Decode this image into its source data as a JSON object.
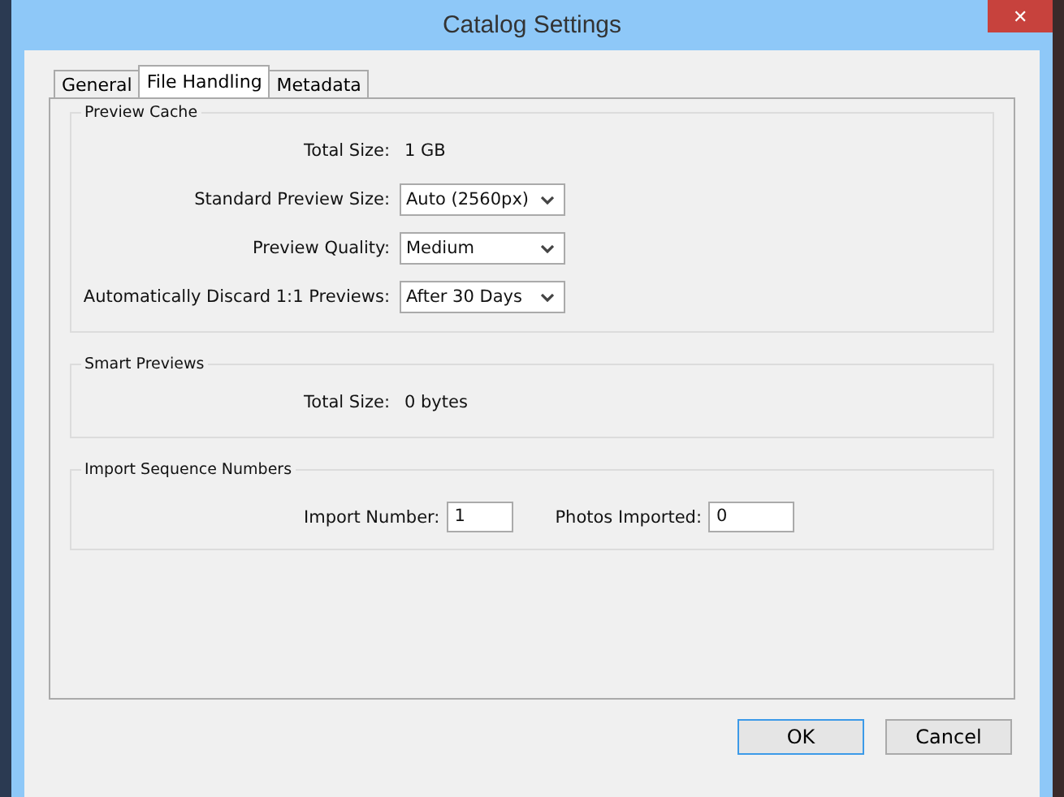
{
  "window": {
    "title": "Catalog Settings",
    "close": "✕"
  },
  "tabs": [
    {
      "label": "General",
      "selected": false
    },
    {
      "label": "File Handling",
      "selected": true
    },
    {
      "label": "Metadata",
      "selected": false
    }
  ],
  "groups": [
    {
      "title": "Preview Cache",
      "rows": [
        {
          "kind": "value",
          "label": "Total Size:",
          "value": "1 GB"
        },
        {
          "kind": "dropdown",
          "label": "Standard Preview Size:",
          "value": "Auto (2560px)"
        },
        {
          "kind": "dropdown",
          "label": "Preview Quality:",
          "value": "Medium"
        },
        {
          "kind": "dropdown",
          "label": "Automatically Discard 1:1 Previews:",
          "value": "After 30 Days"
        }
      ]
    },
    {
      "title": "Smart Previews",
      "rows": [
        {
          "kind": "value",
          "label": "Total Size:",
          "value": "0 bytes"
        }
      ]
    },
    {
      "title": "Import Sequence Numbers",
      "rows": [
        {
          "kind": "field",
          "label": "Import Number:",
          "value": "1"
        },
        {
          "kind": "field",
          "label": "Photos Imported:",
          "value": "0"
        }
      ]
    }
  ],
  "buttons": [
    {
      "label": "OK",
      "default": true
    },
    {
      "label": "Cancel",
      "default": false
    }
  ]
}
